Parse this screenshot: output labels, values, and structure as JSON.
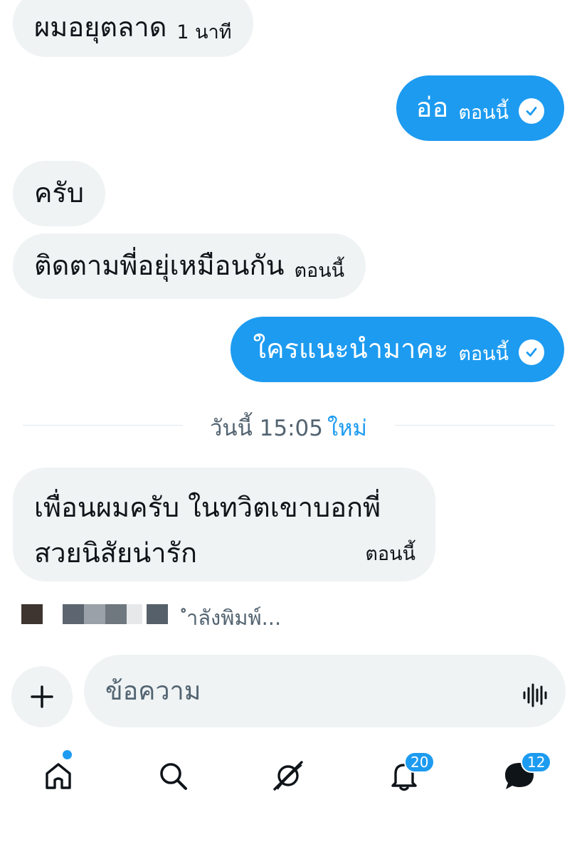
{
  "messages": [
    {
      "text": "ผมอยุตลาด",
      "time": "1 นาที",
      "direction": "incoming"
    },
    {
      "text": "อ่อ",
      "time": "ตอนนี้",
      "direction": "outgoing",
      "status": "sent-check-icon"
    },
    {
      "text": "ครับ",
      "direction": "incoming"
    },
    {
      "text": "ติดตามพี่อยุ่เหมือนกัน",
      "time": "ตอนนี้",
      "direction": "incoming"
    },
    {
      "text": "ใครแนะนำมาคะ",
      "time": "ตอนนี้",
      "direction": "outgoing",
      "status": "sent-check-icon"
    }
  ],
  "divider": {
    "label": "วันนี้ 15:05",
    "new_label": "ใหม่"
  },
  "last_message": {
    "lines": [
      "เพื่อนผมครับ ในทวิตเขาบอกพี่",
      "สวยนิสัยน่ารัก"
    ],
    "time": "ตอนนี้"
  },
  "typing": {
    "label": "ำลังพิมพ์..."
  },
  "composer": {
    "placeholder": "ข้อความ",
    "value": ""
  },
  "nav": {
    "items": [
      "home-icon",
      "search-icon",
      "spaces-icon",
      "bell-icon",
      "messages-icon"
    ],
    "notifications_badge": "20",
    "messages_badge": "12"
  },
  "colors": {
    "accent": "#1d9bf0",
    "bubble_in": "#eff3f4",
    "text": "#0f1419",
    "muted": "#536471"
  }
}
